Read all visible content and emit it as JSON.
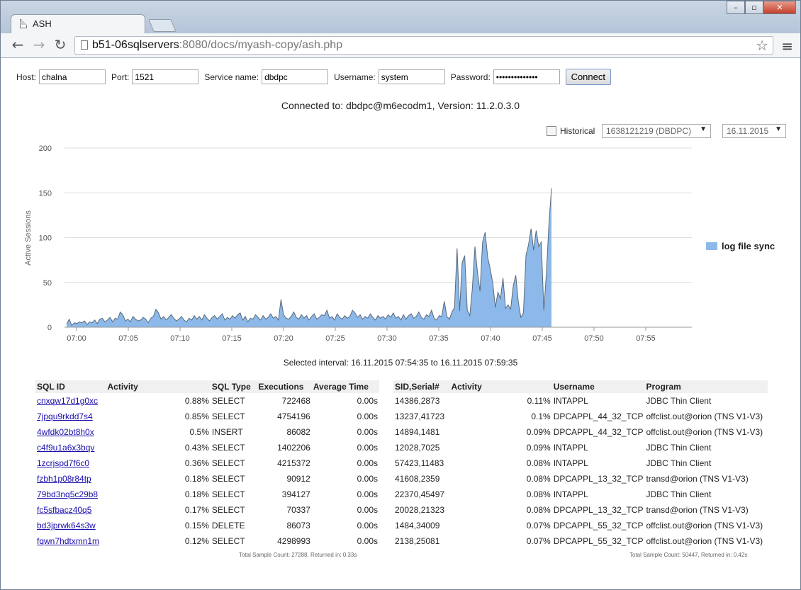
{
  "browser": {
    "tab_title": "ASH",
    "url_host": "b51-06sqlservers",
    "url_rest": ":8080/docs/myash-copy/ash.php"
  },
  "form": {
    "host_label": "Host:",
    "host_value": "chalna",
    "port_label": "Port:",
    "port_value": "1521",
    "service_label": "Service name:",
    "service_value": "dbdpc",
    "username_label": "Username:",
    "username_value": "system",
    "password_label": "Password:",
    "password_value": "••••••••••••••",
    "connect_label": "Connect"
  },
  "connected_text": "Connected to: dbdpc@m6ecodm1, Version: 11.2.0.3.0",
  "controls": {
    "historical_label": "Historical",
    "db_select": "1638121219 (DBDPC)",
    "date_select": "16.11.2015"
  },
  "chart_data": {
    "type": "area",
    "title": "",
    "xlabel": "",
    "ylabel": "Active Sessions",
    "ylim": [
      0,
      200
    ],
    "yticks": [
      0,
      50,
      100,
      150,
      200
    ],
    "xticks": [
      "07:00",
      "07:05",
      "07:10",
      "07:15",
      "07:20",
      "07:25",
      "07:30",
      "07:35",
      "07:40",
      "07:45",
      "07:50",
      "07:55"
    ],
    "x_start": "06:59:15",
    "x_step_seconds": 15,
    "series": [
      {
        "name": "log file sync",
        "color": "#8cb9ea",
        "values": [
          3,
          9,
          2,
          5,
          4,
          6,
          5,
          7,
          3,
          6,
          5,
          8,
          4,
          9,
          10,
          6,
          8,
          11,
          6,
          10,
          9,
          17,
          14,
          7,
          9,
          6,
          12,
          9,
          7,
          8,
          11,
          9,
          5,
          10,
          12,
          20,
          16,
          9,
          12,
          8,
          11,
          14,
          10,
          7,
          9,
          12,
          8,
          6,
          10,
          8,
          13,
          9,
          12,
          8,
          14,
          10,
          7,
          11,
          13,
          9,
          12,
          15,
          8,
          11,
          9,
          13,
          10,
          14,
          16,
          8,
          12,
          6,
          10,
          9,
          14,
          11,
          8,
          13,
          9,
          11,
          15,
          10,
          12,
          8,
          31,
          14,
          10,
          9,
          12,
          17,
          11,
          9,
          14,
          10,
          13,
          8,
          12,
          15,
          9,
          11,
          14,
          13,
          19,
          10,
          12,
          8,
          15,
          11,
          9,
          13,
          10,
          12,
          19,
          16,
          11,
          14,
          9,
          12,
          10,
          15,
          11,
          8,
          13,
          10,
          12,
          9,
          14,
          11,
          16,
          10,
          12,
          8,
          14,
          9,
          13,
          15,
          10,
          12,
          17,
          11,
          9,
          14,
          12,
          19,
          10,
          8,
          13,
          12,
          29,
          12,
          9,
          17,
          22,
          88,
          18,
          72,
          80,
          19,
          13,
          44,
          90,
          61,
          40,
          95,
          106,
          78,
          65,
          49,
          22,
          39,
          32,
          55,
          21,
          25,
          20,
          46,
          58,
          28,
          11,
          16,
          80,
          92,
          110,
          86,
          108,
          90,
          95,
          19,
          60,
          115,
          155
        ]
      }
    ]
  },
  "interval_text": "Selected interval: 16.11.2015 07:54:35 to 16.11.2015 07:59:35",
  "sql_table": {
    "headers": [
      "SQL ID",
      "Activity",
      "SQL Type",
      "Executions",
      "Average Time"
    ],
    "rows": [
      [
        "cnxqw17d1g0xc",
        "0.88%",
        "SELECT",
        "722468",
        "0.00s"
      ],
      [
        "7jpqu9rkdd7s4",
        "0.85%",
        "SELECT",
        "4754196",
        "0.00s"
      ],
      [
        "4wfdk02bt8h0x",
        "0.5%",
        "INSERT",
        "86082",
        "0.00s"
      ],
      [
        "c4f9u1a6x3bqv",
        "0.43%",
        "SELECT",
        "1402206",
        "0.00s"
      ],
      [
        "1zcrjspd7f6c0",
        "0.36%",
        "SELECT",
        "4215372",
        "0.00s"
      ],
      [
        "fzbh1p08r84tp",
        "0.18%",
        "SELECT",
        "90912",
        "0.00s"
      ],
      [
        "79bd3nq5c29b8",
        "0.18%",
        "SELECT",
        "394127",
        "0.00s"
      ],
      [
        "fc5sfbacz40q5",
        "0.17%",
        "SELECT",
        "70337",
        "0.00s"
      ],
      [
        "bd3jprwk64s3w",
        "0.15%",
        "DELETE",
        "86073",
        "0.00s"
      ],
      [
        "fqwn7hdtxmn1m",
        "0.12%",
        "SELECT",
        "4298993",
        "0.00s"
      ]
    ],
    "footer": "Total Sample Count: 27288, Returned in: 0.33s"
  },
  "session_table": {
    "headers": [
      "SID,Serial#",
      "Activity",
      "Username",
      "Program"
    ],
    "rows": [
      [
        "14386,2873",
        "0.11%",
        "INTAPPL",
        "JDBC Thin Client"
      ],
      [
        "13237,41723",
        "0.1%",
        "DPCAPPL_44_32_TCP",
        "offclist.out@orion (TNS V1-V3)"
      ],
      [
        "14894,1481",
        "0.09%",
        "DPCAPPL_44_32_TCP",
        "offclist.out@orion (TNS V1-V3)"
      ],
      [
        "12028,7025",
        "0.09%",
        "INTAPPL",
        "JDBC Thin Client"
      ],
      [
        "57423,11483",
        "0.08%",
        "INTAPPL",
        "JDBC Thin Client"
      ],
      [
        "41608,2359",
        "0.08%",
        "DPCAPPL_13_32_TCP",
        "transd@orion (TNS V1-V3)"
      ],
      [
        "22370,45497",
        "0.08%",
        "INTAPPL",
        "JDBC Thin Client"
      ],
      [
        "20028,21323",
        "0.08%",
        "DPCAPPL_13_32_TCP",
        "transd@orion (TNS V1-V3)"
      ],
      [
        "1484,34009",
        "0.07%",
        "DPCAPPL_55_32_TCP",
        "offclist.out@orion (TNS V1-V3)"
      ],
      [
        "2138,25081",
        "0.07%",
        "DPCAPPL_55_32_TCP",
        "offclist.out@orion (TNS V1-V3)"
      ]
    ],
    "footer": "Total Sample Count: 50447, Returned in: 0.42s"
  }
}
